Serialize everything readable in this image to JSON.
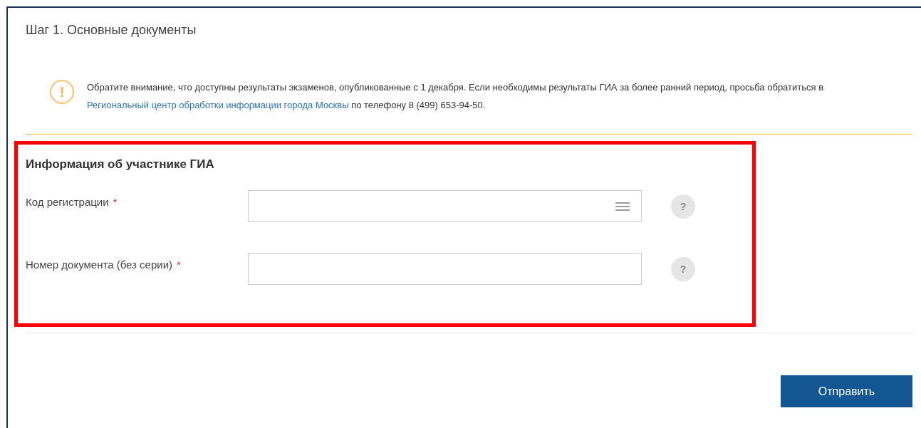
{
  "title": "Шаг 1. Основные документы",
  "notice": {
    "text_before": "Обратите внимание, что доступны результаты экзаменов, опубликованные с 1 декабря. Если необходимы результаты ГИА за более ранний период, просьба обратиться в ",
    "link": "Региональный центр обработки информации города Москвы",
    "text_after": " по телефону 8 (499) 653-94-50.",
    "icon": "!"
  },
  "section": {
    "heading": "Информация об участнике ГИА",
    "fields": [
      {
        "label": "Код регистрации",
        "required_mark": "*",
        "kind": "list",
        "help": "?"
      },
      {
        "label": "Номер документа (без серии)",
        "required_mark": "*",
        "kind": "text",
        "help": "?"
      }
    ]
  },
  "submit": "Отправить"
}
